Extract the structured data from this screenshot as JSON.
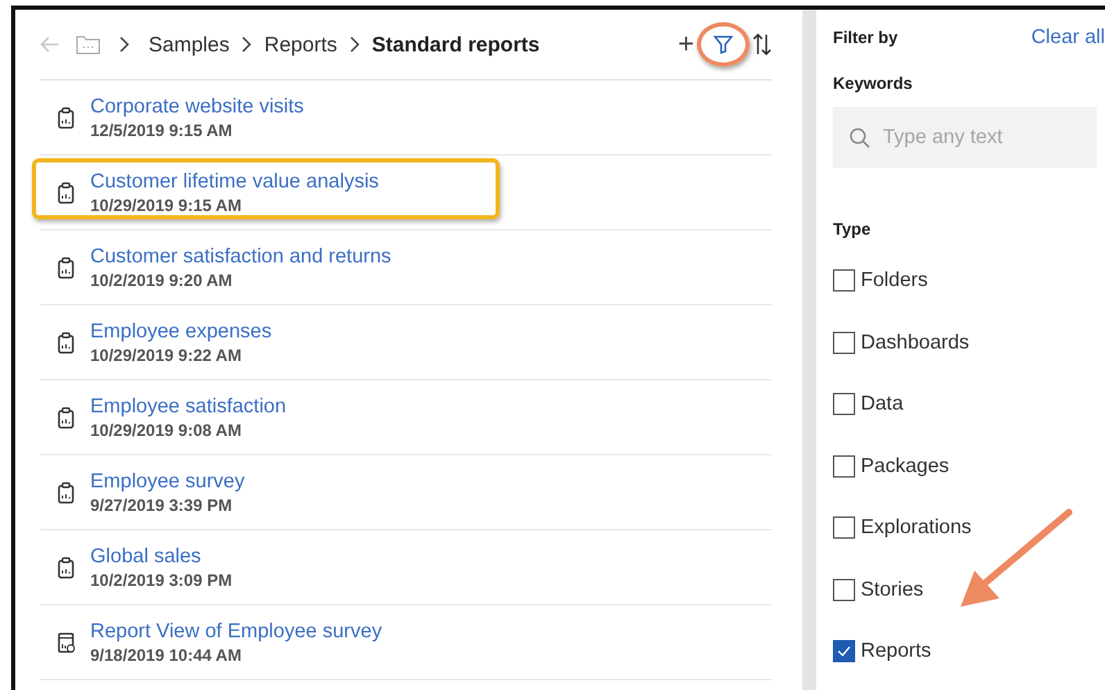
{
  "breadcrumb": {
    "back_disabled": true,
    "items": [
      {
        "label": "Samples",
        "current": false
      },
      {
        "label": "Reports",
        "current": false
      },
      {
        "label": "Standard reports",
        "current": true
      }
    ]
  },
  "toolbar": {
    "add": "+",
    "filter_circled": true
  },
  "reports": [
    {
      "name": "Corporate website visits",
      "date": "12/5/2019 9:15 AM",
      "kind": "report",
      "highlighted": false
    },
    {
      "name": "Customer lifetime value analysis",
      "date": "10/29/2019 9:15 AM",
      "kind": "report",
      "highlighted": true
    },
    {
      "name": "Customer satisfaction and returns",
      "date": "10/2/2019 9:20 AM",
      "kind": "report",
      "highlighted": false
    },
    {
      "name": "Employee expenses",
      "date": "10/29/2019 9:22 AM",
      "kind": "report",
      "highlighted": false
    },
    {
      "name": "Employee satisfaction",
      "date": "10/29/2019 9:08 AM",
      "kind": "report",
      "highlighted": false
    },
    {
      "name": "Employee survey",
      "date": "9/27/2019 3:39 PM",
      "kind": "report",
      "highlighted": false
    },
    {
      "name": "Global sales",
      "date": "10/2/2019 3:09 PM",
      "kind": "report",
      "highlighted": false
    },
    {
      "name": "Report View of Employee survey",
      "date": "9/18/2019 10:44 AM",
      "kind": "report-view",
      "highlighted": false
    }
  ],
  "filter_panel": {
    "title": "Filter by",
    "clear": "Clear all",
    "keywords_label": "Keywords",
    "search": {
      "placeholder": "Type any text"
    },
    "type_label": "Type",
    "types": [
      {
        "label": "Folders",
        "checked": false,
        "arrow": false
      },
      {
        "label": "Dashboards",
        "checked": false,
        "arrow": false
      },
      {
        "label": "Data",
        "checked": false,
        "arrow": false
      },
      {
        "label": "Packages",
        "checked": false,
        "arrow": false
      },
      {
        "label": "Explorations",
        "checked": false,
        "arrow": false
      },
      {
        "label": "Stories",
        "checked": false,
        "arrow": false
      },
      {
        "label": "Reports",
        "checked": true,
        "arrow": true
      }
    ]
  }
}
